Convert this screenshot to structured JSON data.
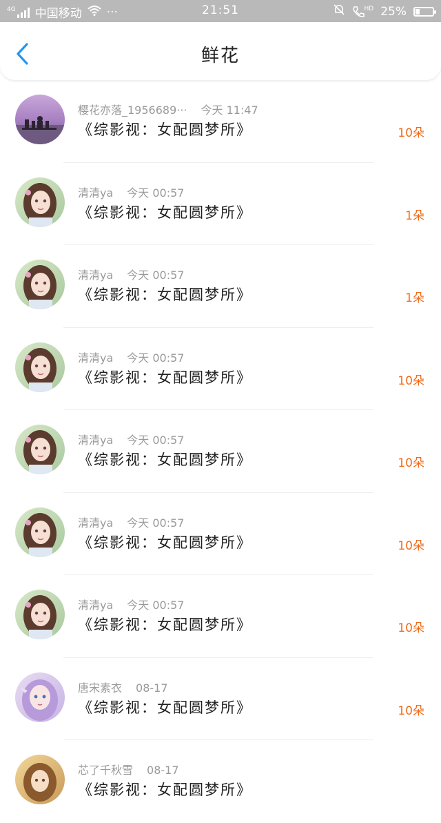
{
  "status": {
    "signal_label": "4G",
    "carrier": "中国移动",
    "dots": "···",
    "time": "21:51",
    "hd_label": "HD",
    "battery": "25%",
    "battery_level": 0.25
  },
  "nav": {
    "title": "鲜花"
  },
  "colors": {
    "accent": "#2196f3",
    "count": "#f06a19"
  },
  "items": [
    {
      "user": "樱花亦落_1956689···",
      "time": "今天 11:47",
      "book": "《综影视：女配圆梦所》",
      "count": "10朵",
      "avatar": "lake-pier"
    },
    {
      "user": "清清ya",
      "time": "今天 00:57",
      "book": "《综影视：女配圆梦所》",
      "count": "1朵",
      "avatar": "anime-girl-brown"
    },
    {
      "user": "清清ya",
      "time": "今天 00:57",
      "book": "《综影视：女配圆梦所》",
      "count": "1朵",
      "avatar": "anime-girl-brown"
    },
    {
      "user": "清清ya",
      "time": "今天 00:57",
      "book": "《综影视：女配圆梦所》",
      "count": "10朵",
      "avatar": "anime-girl-brown"
    },
    {
      "user": "清清ya",
      "time": "今天 00:57",
      "book": "《综影视：女配圆梦所》",
      "count": "10朵",
      "avatar": "anime-girl-brown"
    },
    {
      "user": "清清ya",
      "time": "今天 00:57",
      "book": "《综影视：女配圆梦所》",
      "count": "10朵",
      "avatar": "anime-girl-brown"
    },
    {
      "user": "清清ya",
      "time": "今天 00:57",
      "book": "《综影视：女配圆梦所》",
      "count": "10朵",
      "avatar": "anime-girl-brown"
    },
    {
      "user": "唐宋素衣",
      "time": "08-17",
      "book": "《综影视：女配圆梦所》",
      "count": "10朵",
      "avatar": "anime-girl-purple"
    },
    {
      "user": "芯了千秋雪",
      "time": "08-17",
      "book": "《综影视：女配圆梦所》",
      "count": "",
      "avatar": "anime-girl-blonde"
    }
  ]
}
